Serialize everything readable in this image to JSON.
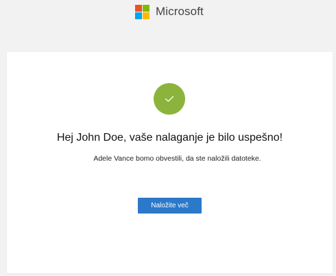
{
  "header": {
    "brand_name": "Microsoft",
    "logo_icon": "microsoft-logo-icon",
    "logo_colors": [
      "#f25022",
      "#7fba00",
      "#00a4ef",
      "#ffb900"
    ]
  },
  "card": {
    "status_icon": "checkmark-icon",
    "title": "Hej John Doe, vaše nalaganje je bilo uspešno!",
    "message": "Adele Vance bomo obvestili, da ste naložili datoteke.",
    "upload_more_label": "Naložite več"
  },
  "colors": {
    "page_background": "#f2f2f2",
    "card_background": "#ffffff",
    "success": "#8cb43c",
    "accent": "#2b79c8"
  }
}
